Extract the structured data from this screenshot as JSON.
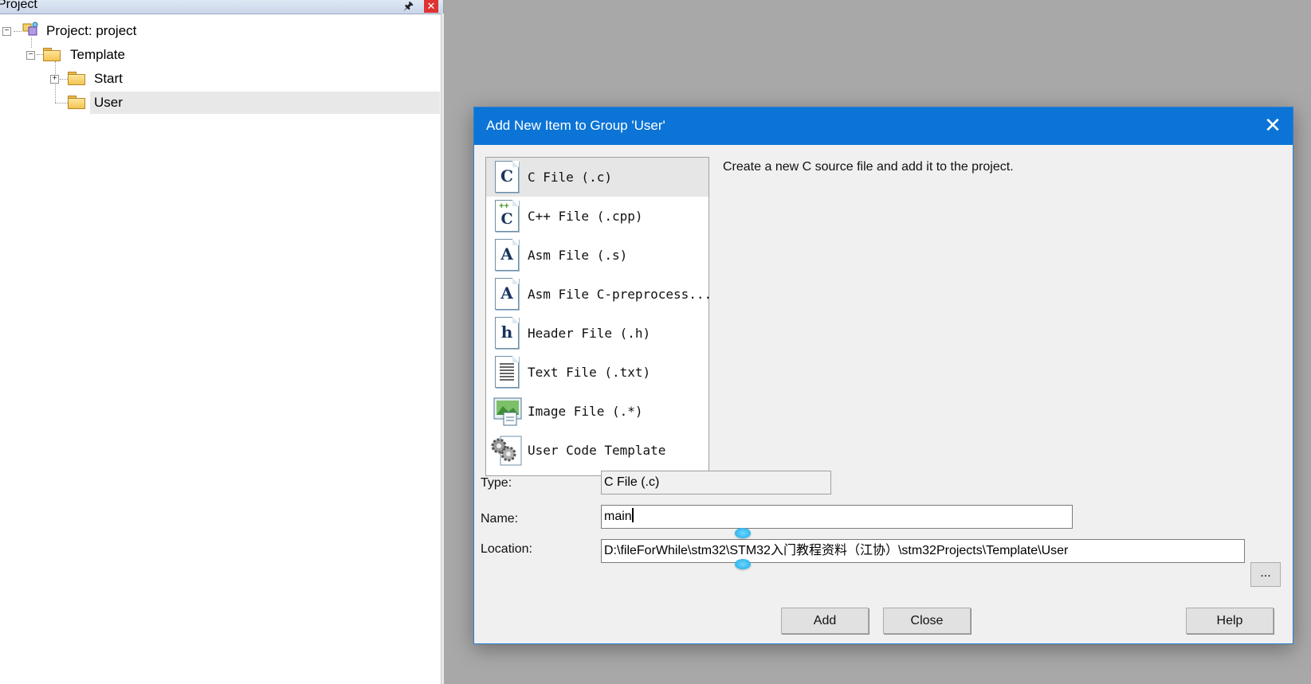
{
  "project_panel": {
    "title": "Project",
    "pin_icon": "pin-icon",
    "close_icon": "close-icon",
    "tree": {
      "root": "Project: project",
      "group": "Template",
      "folders": [
        "Start",
        "User"
      ],
      "selected": "User"
    }
  },
  "dialog": {
    "title": "Add New Item to Group 'User'",
    "description": "Create a new C source file and add it to the project.",
    "items": [
      {
        "icon": "C",
        "label": "C File (.c)"
      },
      {
        "icon": "C++",
        "label": "C++ File (.cpp)"
      },
      {
        "icon": "A",
        "label": "Asm File (.s)"
      },
      {
        "icon": "A",
        "label": "Asm File C-preprocess..."
      },
      {
        "icon": "h",
        "label": "Header File (.h)"
      },
      {
        "icon": "text-file",
        "label": "Text File (.txt)"
      },
      {
        "icon": "image-file",
        "label": "Image File (.*)"
      },
      {
        "icon": "gears",
        "label": "User Code Template"
      }
    ],
    "selected_item": "C File (.c)",
    "type_label": "Type:",
    "type_value": "C File (.c)",
    "name_label": "Name:",
    "name_value": "main",
    "location_label": "Location:",
    "location_value": "D:\\fileForWhile\\stm32\\STM32入门教程资料（江协）\\stm32Projects\\Template\\User",
    "browse_label": "...",
    "buttons": {
      "add": "Add",
      "close": "Close",
      "help": "Help"
    }
  },
  "colors": {
    "titlebar": "#0b74d6",
    "background": "#a8a8a8",
    "selection": "#e6e6e6"
  }
}
